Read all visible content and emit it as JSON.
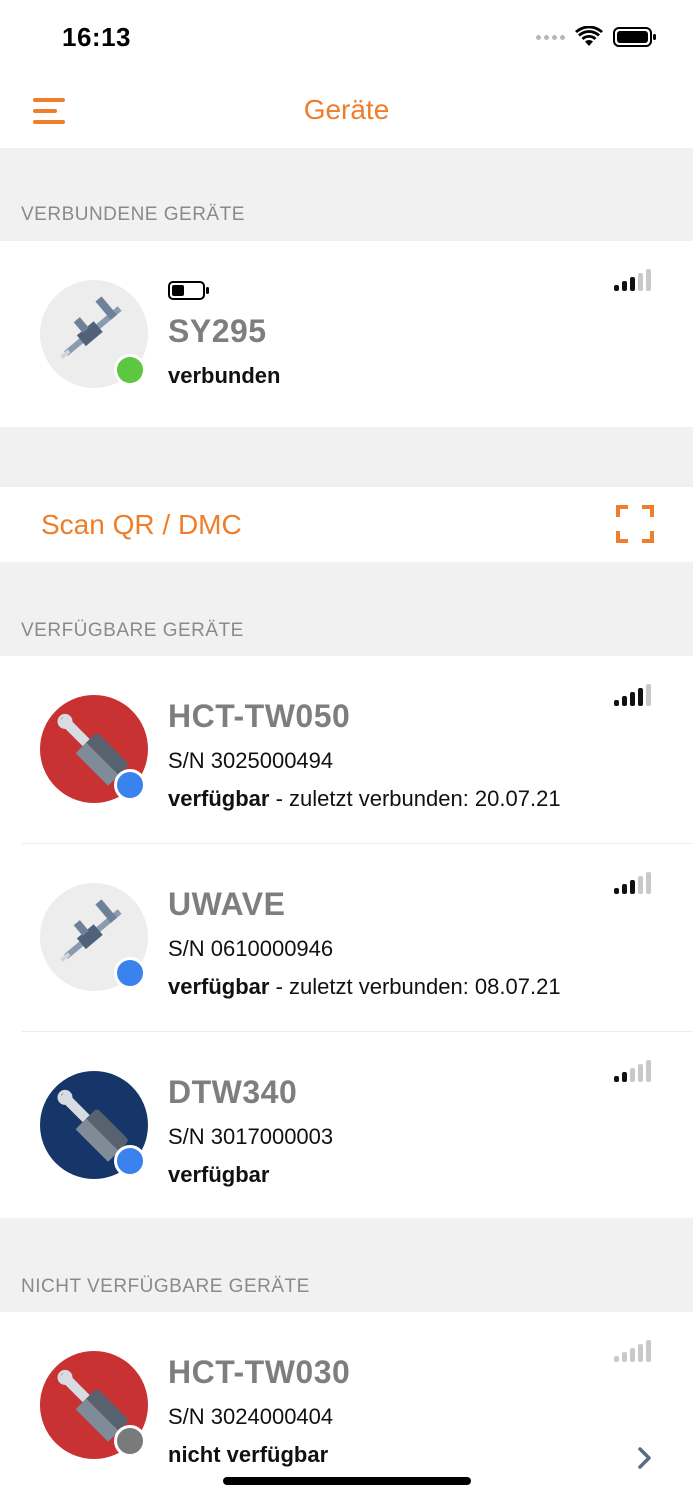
{
  "status_bar": {
    "time": "16:13"
  },
  "nav": {
    "title": "Geräte"
  },
  "sections": {
    "connected": "VERBUNDENE GERÄTE",
    "available": "VERFÜGBARE GERÄTE",
    "unavailable": "NICHT VERFÜGBARE GERÄTE"
  },
  "connected_device": {
    "name": "SY295",
    "state": "verbunden",
    "battery_level": 0.35,
    "signal_bars": 3,
    "status_color": "#5cc83f",
    "icon": "caliper-icon"
  },
  "scan": {
    "label": "Scan QR / DMC",
    "icon": "qr-scan-icon"
  },
  "available_devices": [
    {
      "name": "HCT-TW050",
      "sn": "S/N 3025000494",
      "state": "verfügbar",
      "extra": " - zuletzt verbunden: 20.07.21",
      "signal_bars": 4,
      "avatar_color": "#c83232",
      "status_color": "#3a82ee",
      "icon": "probe-icon"
    },
    {
      "name": "UWAVE",
      "sn": "S/N 0610000946",
      "state": "verfügbar",
      "extra": " - zuletzt verbunden: 08.07.21",
      "signal_bars": 3,
      "avatar_color": "#ededed",
      "status_color": "#3a82ee",
      "icon": "caliper-icon"
    },
    {
      "name": "DTW340",
      "sn": "S/N 3017000003",
      "state": "verfügbar",
      "extra": "",
      "signal_bars": 2,
      "avatar_color": "#16366a",
      "status_color": "#3a82ee",
      "icon": "probe-icon"
    }
  ],
  "unavailable_devices": [
    {
      "name": "HCT-TW030",
      "sn": "S/N 3024000404",
      "state": "nicht verfügbar",
      "signal_bars": 0,
      "avatar_color": "#c83232",
      "status_color": "#7a7a7a",
      "icon": "probe-icon"
    }
  ],
  "colors": {
    "accent": "#ef7d2a",
    "background": "#f1f1f1"
  }
}
